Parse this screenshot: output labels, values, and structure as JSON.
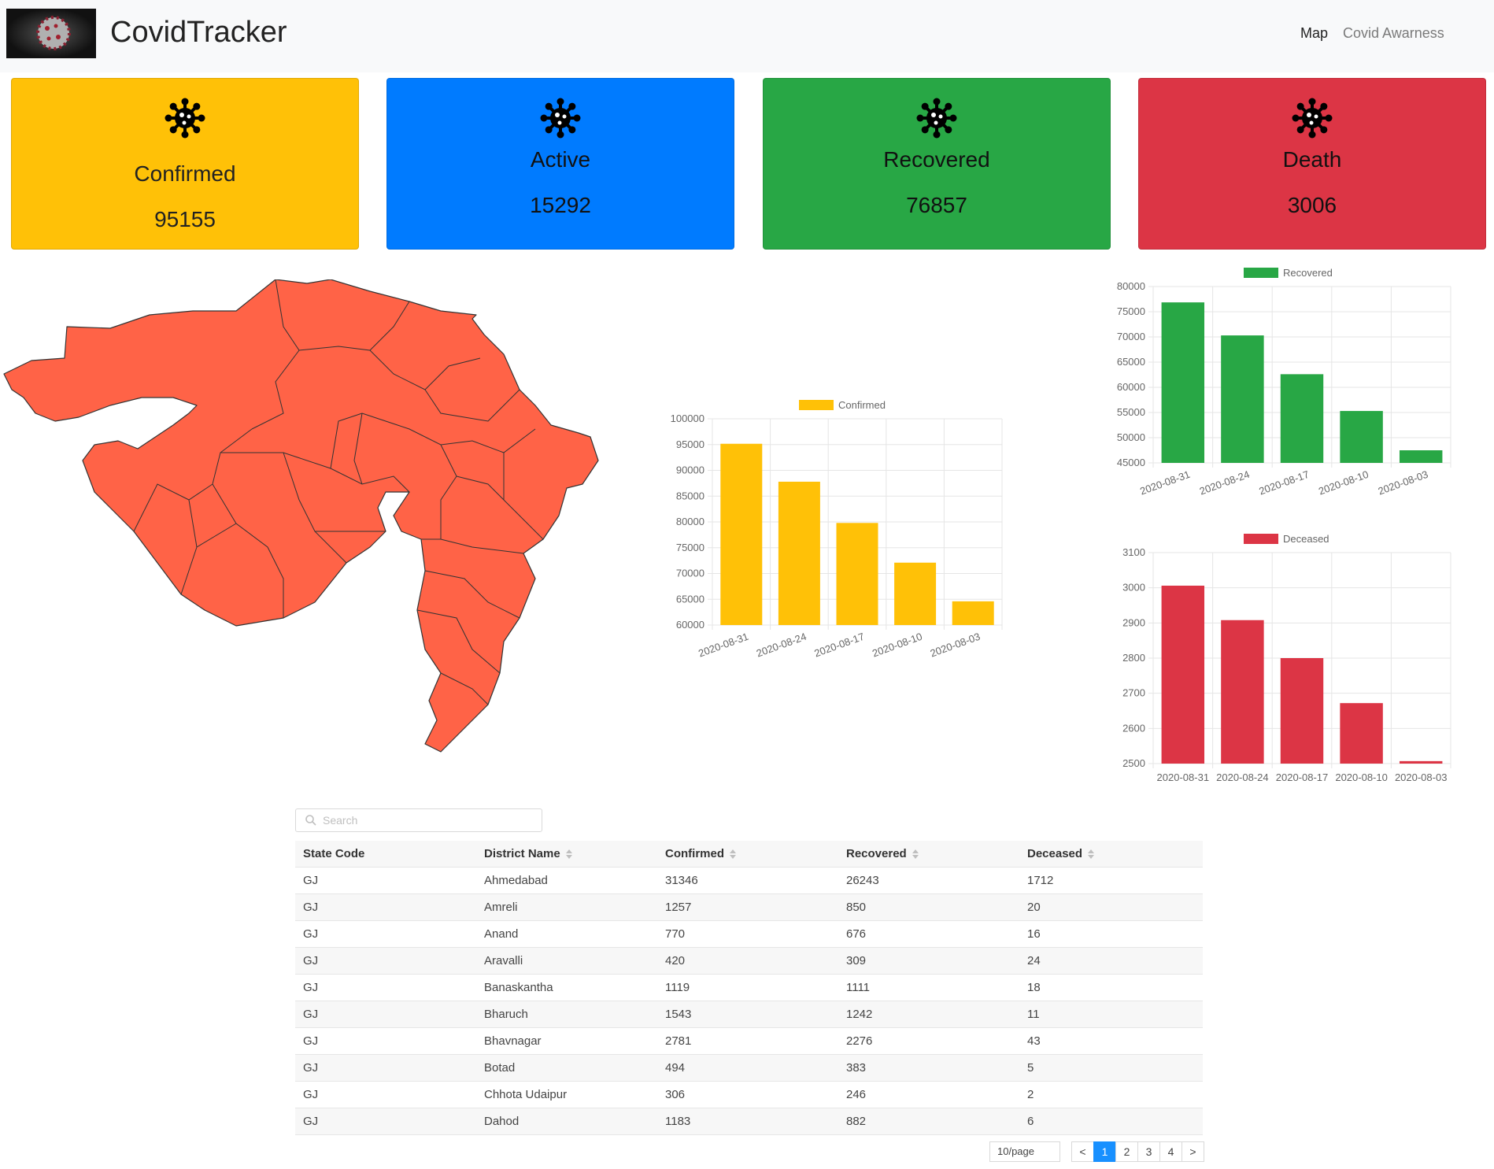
{
  "navbar": {
    "brand": "CovidTracker",
    "links": [
      "Map",
      "Covid Awarness"
    ]
  },
  "cards": [
    {
      "title": "Confirmed",
      "value": "95155",
      "color": "#ffc107"
    },
    {
      "title": "Active",
      "value": "15292",
      "color": "#007bff"
    },
    {
      "title": "Recovered",
      "value": "76857",
      "color": "#28a745"
    },
    {
      "title": "Death",
      "value": "3006",
      "color": "#dc3545"
    }
  ],
  "icons": {
    "card_icon": "virus-icon",
    "logo": "coronavirus-logo",
    "search": "search-icon",
    "sort": "sort-icon"
  },
  "map": {
    "region": "Gujarat districts",
    "fill": "#ff6347"
  },
  "chart_data": [
    {
      "type": "bar",
      "categories": [
        "2020-08-31",
        "2020-08-24",
        "2020-08-17",
        "2020-08-10",
        "2020-08-03"
      ],
      "series": [
        {
          "name": "Confirmed",
          "values": [
            95155,
            87800,
            79800,
            72100,
            64600
          ]
        }
      ],
      "color": "#ffc107",
      "ylim": [
        60000,
        100000
      ],
      "yticks": [
        100000,
        95000,
        90000,
        85000,
        80000,
        75000,
        70000,
        65000,
        60000
      ],
      "legend": "top",
      "xlabel_rotation": "rotated"
    },
    {
      "type": "bar",
      "categories": [
        "2020-08-31",
        "2020-08-24",
        "2020-08-17",
        "2020-08-10",
        "2020-08-03"
      ],
      "series": [
        {
          "name": "Recovered",
          "values": [
            76857,
            70300,
            62600,
            55300,
            47500
          ]
        }
      ],
      "color": "#28a745",
      "ylim": [
        45000,
        80000
      ],
      "yticks": [
        80000,
        75000,
        70000,
        65000,
        60000,
        55000,
        50000,
        45000
      ],
      "legend": "top",
      "xlabel_rotation": "rotated"
    },
    {
      "type": "bar",
      "categories": [
        "2020-08-31",
        "2020-08-24",
        "2020-08-17",
        "2020-08-10",
        "2020-08-03"
      ],
      "series": [
        {
          "name": "Deceased",
          "values": [
            3006,
            2908,
            2800,
            2672,
            2507
          ]
        }
      ],
      "color": "#dc3545",
      "ylim": [
        2500,
        3100
      ],
      "yticks": [
        3100,
        3000,
        2900,
        2800,
        2700,
        2600,
        2500
      ],
      "legend": "top",
      "xlabel_rotation": "none"
    }
  ],
  "table": {
    "search_placeholder": "Search",
    "columns": [
      "State Code",
      "District Name",
      "Confirmed",
      "Recovered",
      "Deceased"
    ],
    "rows": [
      [
        "GJ",
        "Ahmedabad",
        "31346",
        "26243",
        "1712"
      ],
      [
        "GJ",
        "Amreli",
        "1257",
        "850",
        "20"
      ],
      [
        "GJ",
        "Anand",
        "770",
        "676",
        "16"
      ],
      [
        "GJ",
        "Aravalli",
        "420",
        "309",
        "24"
      ],
      [
        "GJ",
        "Banaskantha",
        "1119",
        "1111",
        "18"
      ],
      [
        "GJ",
        "Bharuch",
        "1543",
        "1242",
        "11"
      ],
      [
        "GJ",
        "Bhavnagar",
        "2781",
        "2276",
        "43"
      ],
      [
        "GJ",
        "Botad",
        "494",
        "383",
        "5"
      ],
      [
        "GJ",
        "Chhota Udaipur",
        "306",
        "246",
        "2"
      ],
      [
        "GJ",
        "Dahod",
        "1183",
        "882",
        "6"
      ]
    ],
    "page_size": "10/page",
    "pages": [
      "1",
      "2",
      "3",
      "4"
    ],
    "current_page": "1",
    "prev": "<",
    "next": ">"
  }
}
